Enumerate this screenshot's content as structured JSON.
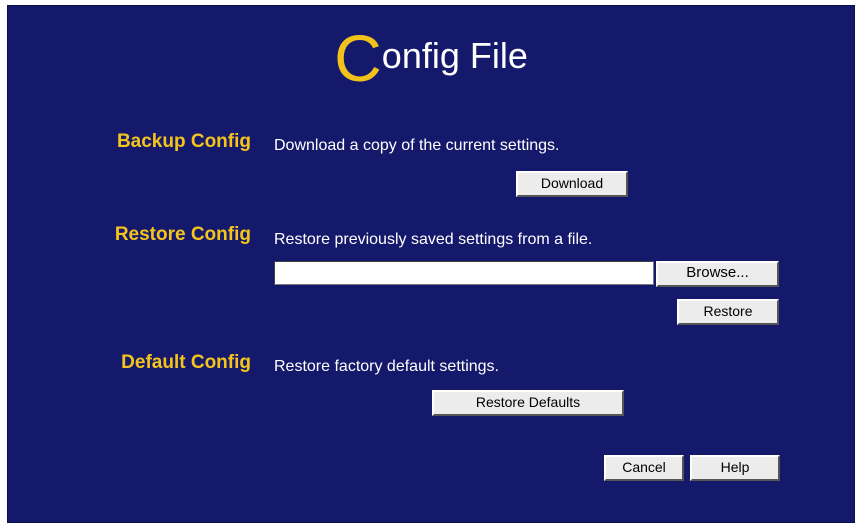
{
  "page": {
    "title_initial": "C",
    "title_rest": "onfig File"
  },
  "backup": {
    "label": "Backup Config",
    "description": "Download a copy of the current settings.",
    "download_button": "Download"
  },
  "restore": {
    "label": "Restore Config",
    "description": "Restore previously saved settings from a file.",
    "file_value": "",
    "browse_button": "Browse...",
    "restore_button": "Restore"
  },
  "defaults": {
    "label": "Default Config",
    "description": "Restore factory default settings.",
    "restore_defaults_button": "Restore Defaults"
  },
  "footer": {
    "cancel_button": "Cancel",
    "help_button": "Help"
  },
  "colors": {
    "background": "#14196b",
    "accent": "#f5c41c",
    "text": "#ffffff"
  }
}
